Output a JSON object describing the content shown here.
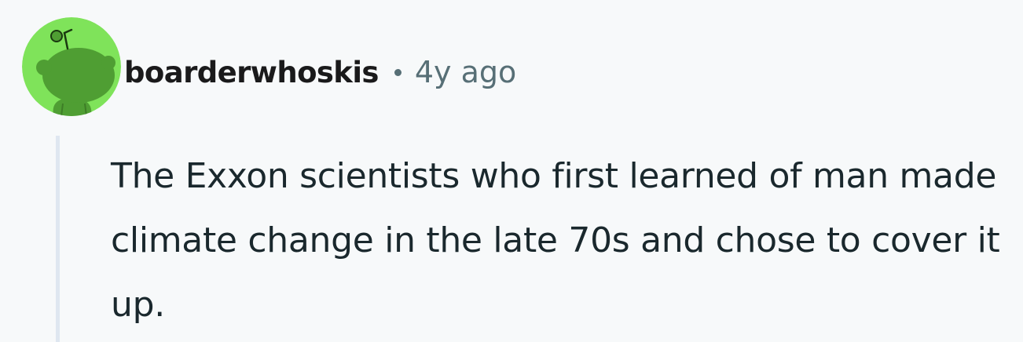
{
  "comment": {
    "author": "boarderwhoskis",
    "separator": "•",
    "timestamp": "4y ago",
    "body": "The Exxon scientists who first learned of man made climate change in the late 70s and chose to cover it up.",
    "avatar_icon": "snoo-avatar-icon"
  },
  "colors": {
    "background": "#f7f9fa",
    "avatar_bg": "#7fe35a",
    "avatar_figure": "#4f9e33",
    "author_text": "#1a1a1b",
    "meta_text": "#576f76",
    "body_text": "#1a282d",
    "thread_line": "#dfe7f0"
  }
}
